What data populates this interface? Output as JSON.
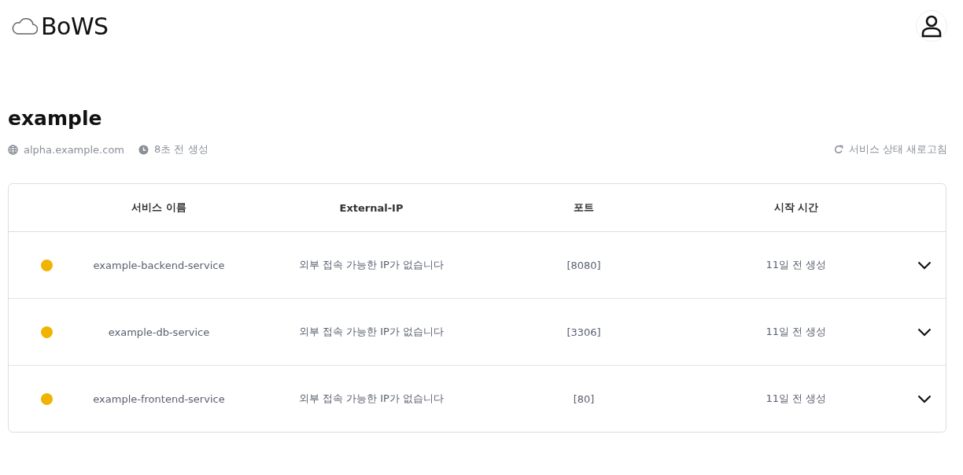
{
  "header": {
    "logo": "BoWS"
  },
  "project": {
    "title": "example",
    "domain": "alpha.example.com",
    "created": "8초 전 생성",
    "refresh": "서비스 상태 새로고침"
  },
  "table": {
    "columns": [
      "서비스 이름",
      "External-IP",
      "포트",
      "시작 시간"
    ],
    "rows": [
      {
        "color": "#f0b400",
        "name": "example-backend-service",
        "external_ip": "외부 접속 가능한 IP가 없습니다",
        "port": "[8080]",
        "started": "11일 전 생성",
        "expanded": false
      },
      {
        "color": "#f0b400",
        "name": "example-db-service",
        "external_ip": "외부 접속 가능한 IP가 없습니다",
        "port": "[3306]",
        "started": "11일 전 생성",
        "expanded": false
      },
      {
        "color": "#f0b400",
        "name": "example-frontend-service",
        "external_ip": "외부 접속 가능한 IP가 없습니다",
        "port": "[80]",
        "started": "11일 전 생성",
        "expanded": false
      }
    ]
  }
}
